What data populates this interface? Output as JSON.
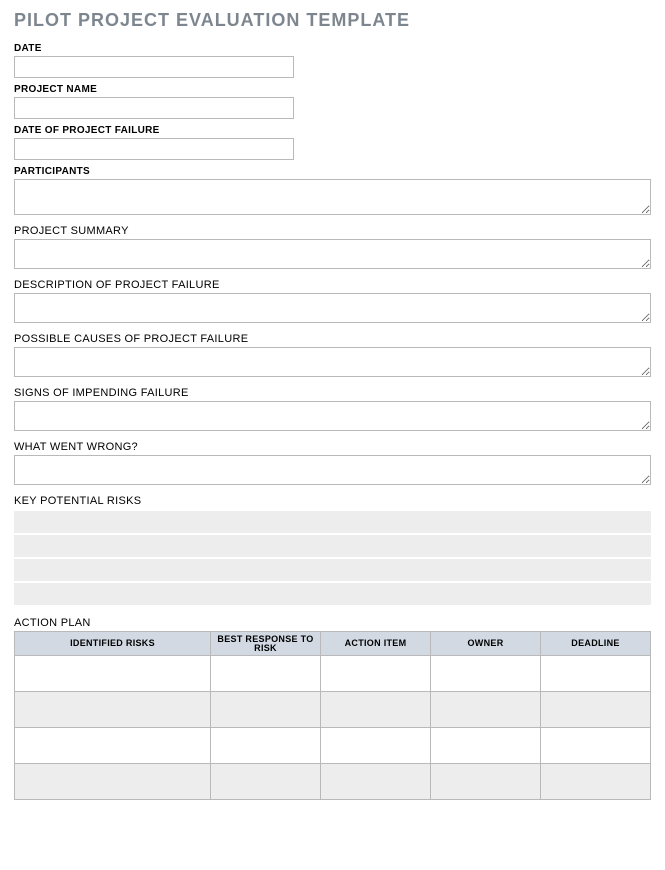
{
  "title": "PILOT PROJECT EVALUATION TEMPLATE",
  "fields": {
    "date": {
      "label": "DATE",
      "value": ""
    },
    "project_name": {
      "label": "PROJECT NAME",
      "value": ""
    },
    "date_of_failure": {
      "label": "DATE OF PROJECT FAILURE",
      "value": ""
    },
    "participants": {
      "label": "PARTICIPANTS",
      "value": ""
    },
    "project_summary": {
      "label": "PROJECT SUMMARY",
      "value": ""
    },
    "description_failure": {
      "label": "DESCRIPTION OF PROJECT FAILURE",
      "value": ""
    },
    "possible_causes": {
      "label": "POSSIBLE CAUSES OF PROJECT FAILURE",
      "value": ""
    },
    "signs_impending": {
      "label": "SIGNS OF IMPENDING FAILURE",
      "value": ""
    },
    "what_went_wrong": {
      "label": "WHAT WENT WRONG?",
      "value": ""
    }
  },
  "key_risks": {
    "label": "KEY POTENTIAL RISKS",
    "rows": [
      "",
      "",
      "",
      ""
    ]
  },
  "action_plan": {
    "label": "ACTION PLAN",
    "headers": [
      "IDENTIFIED RISKS",
      "BEST RESPONSE TO RISK",
      "ACTION ITEM",
      "OWNER",
      "DEADLINE"
    ],
    "rows": [
      [
        "",
        "",
        "",
        "",
        ""
      ],
      [
        "",
        "",
        "",
        "",
        ""
      ],
      [
        "",
        "",
        "",
        "",
        ""
      ],
      [
        "",
        "",
        "",
        "",
        ""
      ]
    ]
  }
}
